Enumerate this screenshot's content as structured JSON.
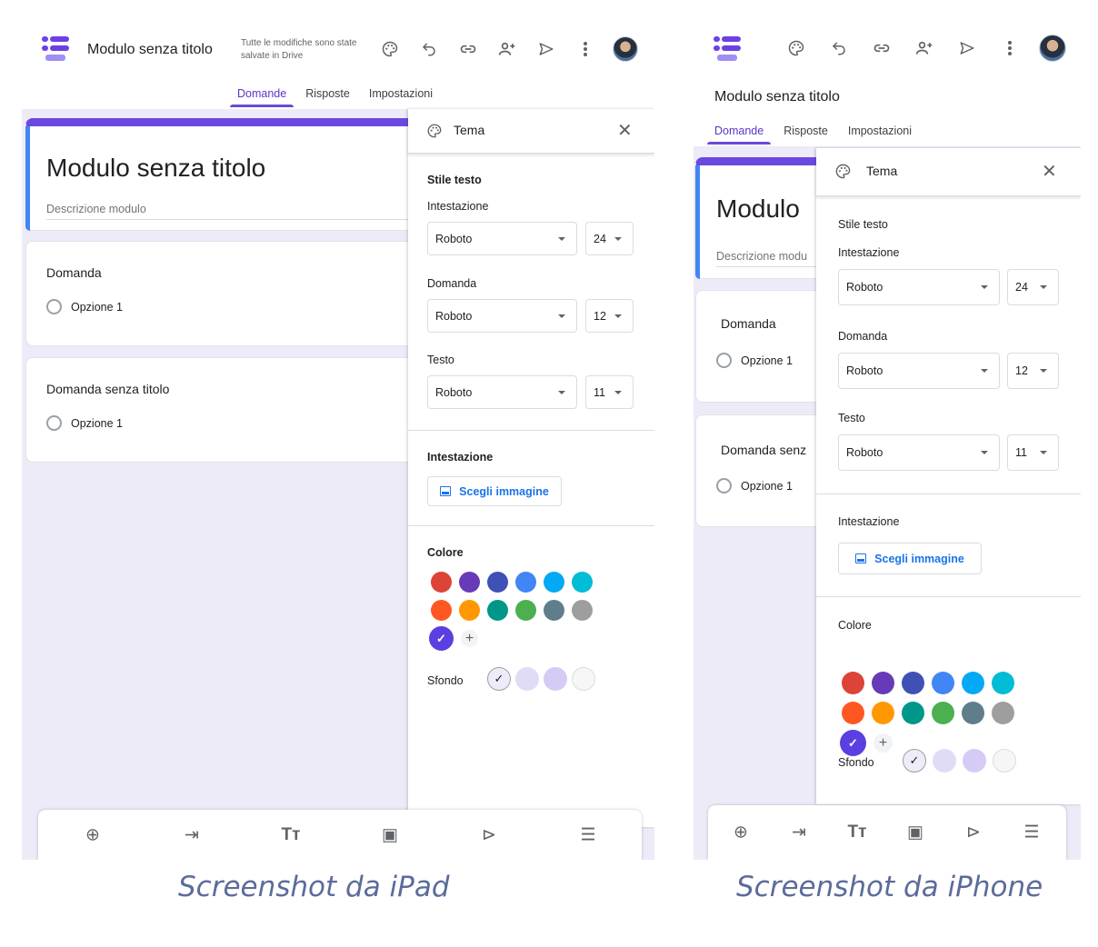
{
  "app": {
    "form_title": "Modulo senza titolo",
    "saved_status": "Tutte le modifiche sono state salvate in Drive",
    "iphone_title_truncated": "Modulo",
    "iphone_q2_truncated": "Domanda senz",
    "iphone_desc_truncated": "Descrizione modu",
    "description_placeholder": "Descrizione modulo"
  },
  "tabs": [
    "Domande",
    "Risposte",
    "Impostazioni"
  ],
  "questions": [
    {
      "title": "Domanda",
      "option": "Opzione 1"
    },
    {
      "title": "Domanda senza titolo",
      "option": "Opzione 1"
    }
  ],
  "theme_panel": {
    "title": "Tema",
    "text_style_label": "Stile testo",
    "header_label": "Intestazione",
    "question_label": "Domanda",
    "text_label": "Testo",
    "header_font": "Roboto",
    "header_size": "24",
    "question_font": "Roboto",
    "question_size": "12",
    "text_font": "Roboto",
    "text_size": "11",
    "header_section_label": "Intestazione",
    "choose_image": "Scegli immagine",
    "color_label": "Colore",
    "background_label": "Sfondo",
    "colors": [
      "#db4437",
      "#673ab7",
      "#3f51b5",
      "#4285f4",
      "#03a9f4",
      "#00bcd4",
      "#ff5722",
      "#ff9800",
      "#009688",
      "#4caf50",
      "#607d8b",
      "#9e9e9e"
    ],
    "selected_color": "#5b3fe0",
    "backgrounds": [
      "#f0ebf8",
      "#e1dcf6",
      "#d5cbf5",
      "#f6f6f6"
    ]
  },
  "icons": [
    "forms-logo-icon",
    "palette-icon",
    "undo-icon",
    "link-icon",
    "add-collaborator-icon",
    "send-icon",
    "more-vert-icon",
    "avatar",
    "close-icon",
    "image-icon",
    "add-question-icon",
    "import-questions-icon",
    "add-title-icon",
    "add-image-icon",
    "add-video-icon",
    "add-section-icon"
  ],
  "captions": {
    "ipad": "Screenshot da iPad",
    "iphone": "Screenshot da iPhone"
  }
}
